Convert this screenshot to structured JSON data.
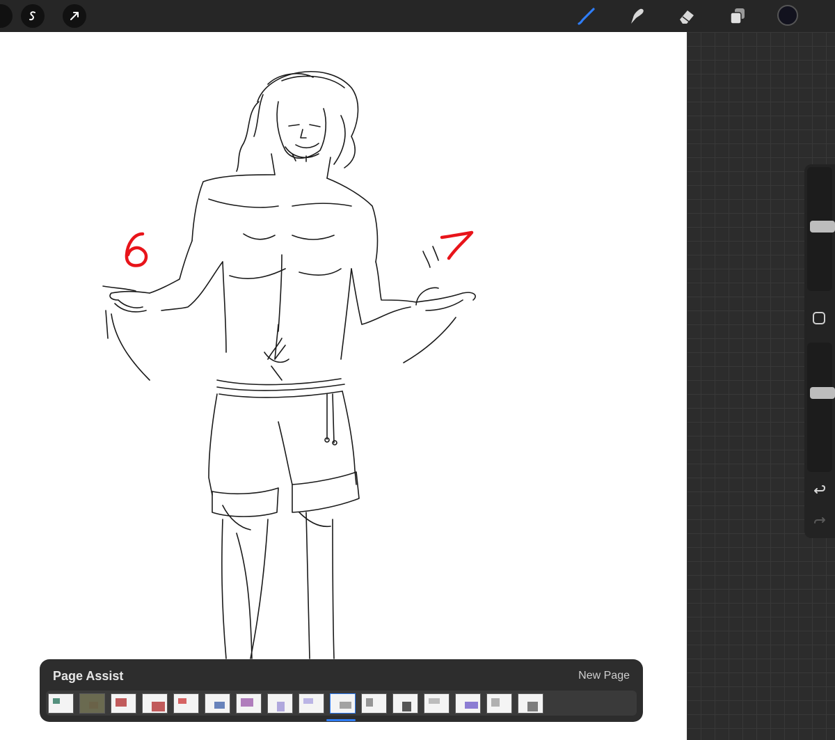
{
  "toolbar": {
    "left_buttons": [
      {
        "name": "selection-icon"
      },
      {
        "name": "transform-icon"
      }
    ],
    "tools": [
      {
        "name": "brush-icon",
        "active": true,
        "color": "#2f7df6"
      },
      {
        "name": "smudge-icon",
        "active": false
      },
      {
        "name": "eraser-icon",
        "active": false
      },
      {
        "name": "layers-icon",
        "active": false
      }
    ],
    "current_color": "#12121e"
  },
  "canvas": {
    "annotations": [
      "6",
      "7"
    ],
    "annotation_color": "#e8141a"
  },
  "sidebar": {
    "brush_size_level": 0.52,
    "opacity_level": 0.62,
    "buttons": [
      "modify-button",
      "undo-button",
      "redo-button"
    ]
  },
  "page_assist": {
    "title": "Page Assist",
    "new_page_label": "New Page",
    "page_count": 16,
    "current_page": 10
  }
}
